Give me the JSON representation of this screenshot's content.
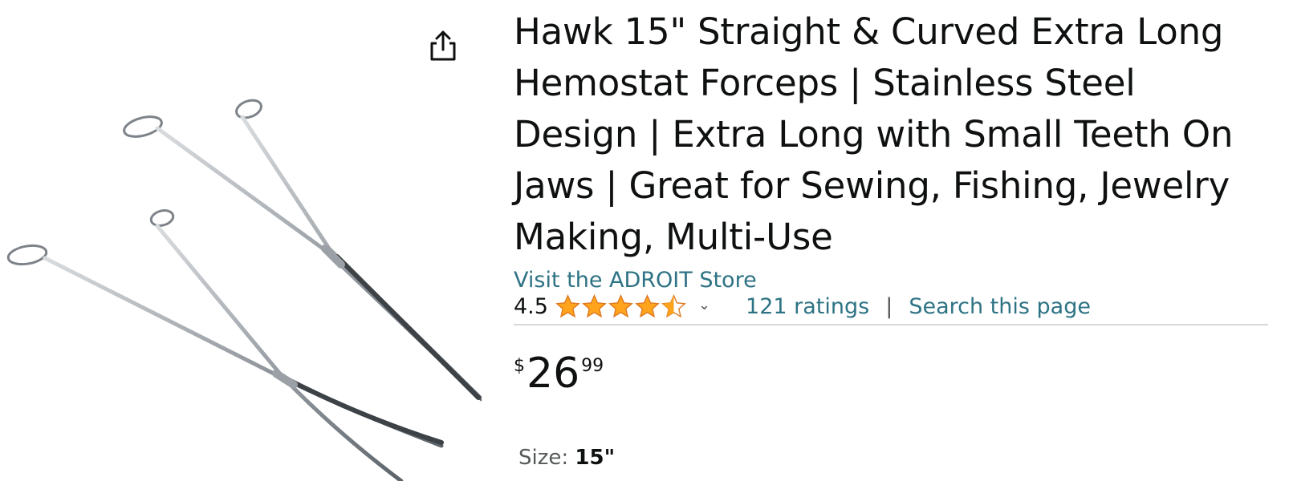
{
  "product": {
    "title": "Hawk 15\" Straight & Curved Extra Long Hemostat Forceps | Stainless Steel Design | Extra Long with Small Teeth On Jaws | Great for Sewing, Fishing, Jewelry Making, Multi-Use",
    "store_link": "Visit the ADROIT Store",
    "rating": "4.5",
    "rating_value": 4.5,
    "ratings_count": "121 ratings",
    "separator": "|",
    "search_link": "Search this page",
    "price": {
      "symbol": "$",
      "whole": "26",
      "fraction": "99"
    },
    "size": {
      "label": "Size: ",
      "value": "15\""
    }
  },
  "icons": {
    "share": "share-icon",
    "star": "star-icon",
    "chevron": "chevron-down-icon"
  },
  "colors": {
    "link": "#2e7384",
    "star": "#ffa41c",
    "text": "#0f1111",
    "divider": "#d5d9d9"
  }
}
